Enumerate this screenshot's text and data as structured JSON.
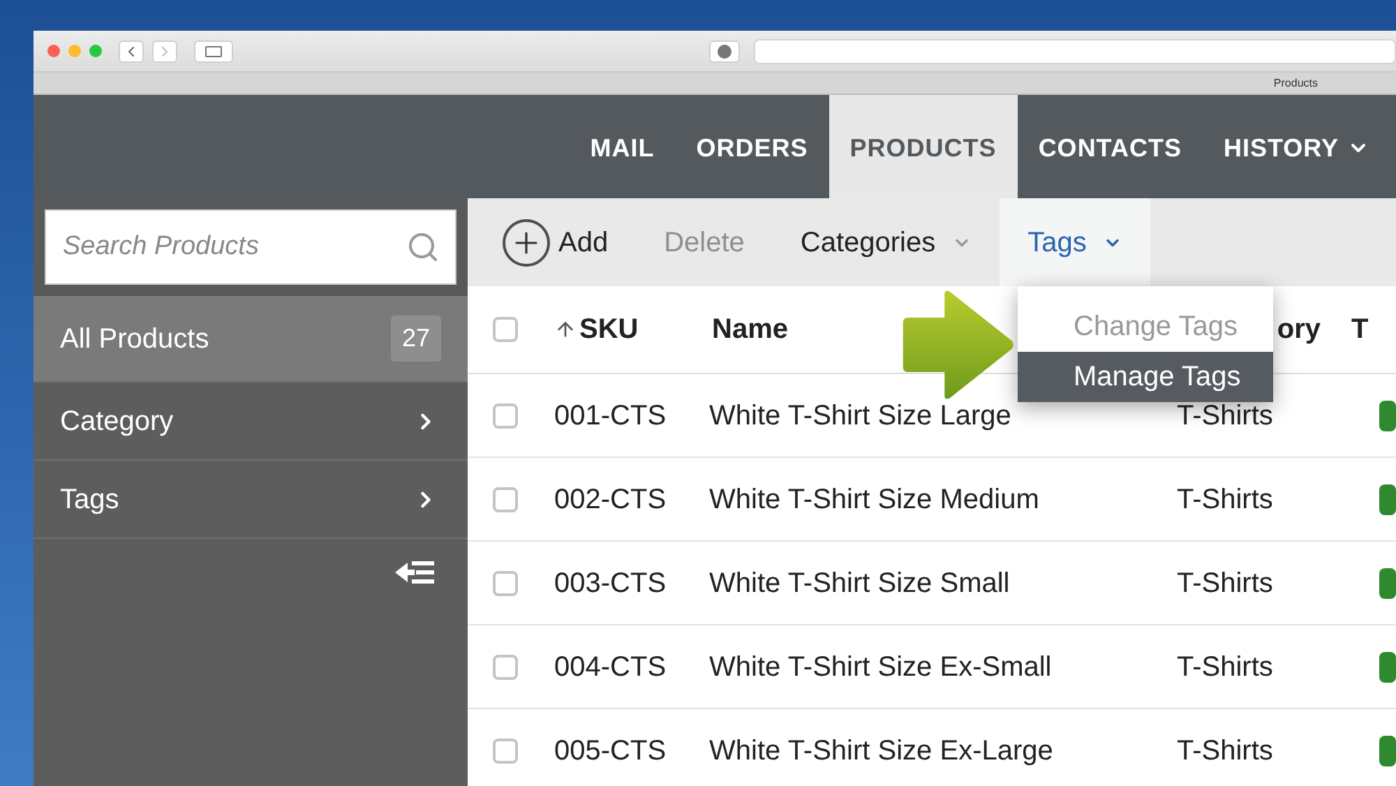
{
  "window": {
    "tab_title": "Products"
  },
  "nav": [
    {
      "label": "MAIL",
      "selected": false,
      "has_caret": false
    },
    {
      "label": "ORDERS",
      "selected": false,
      "has_caret": false
    },
    {
      "label": "PRODUCTS",
      "selected": true,
      "has_caret": false
    },
    {
      "label": "CONTACTS",
      "selected": false,
      "has_caret": false
    },
    {
      "label": "HISTORY",
      "selected": false,
      "has_caret": true
    }
  ],
  "search": {
    "placeholder": "Search Products"
  },
  "sidebar": {
    "items": [
      {
        "label": "All Products",
        "selected": true,
        "count": "27"
      },
      {
        "label": "Category",
        "selected": false
      },
      {
        "label": "Tags",
        "selected": false
      }
    ]
  },
  "toolbar": [
    {
      "kind": "add",
      "label": "Add",
      "disabled": false,
      "selected": false
    },
    {
      "kind": "plain",
      "label": "Delete",
      "disabled": true,
      "selected": false
    },
    {
      "kind": "menu",
      "label": "Categories",
      "disabled": false,
      "selected": false
    },
    {
      "kind": "menu",
      "label": "Tags",
      "disabled": false,
      "selected": true
    }
  ],
  "menu": {
    "items": [
      {
        "label": "Change Tags",
        "disabled": true,
        "selected": false
      },
      {
        "label": "Manage Tags",
        "disabled": false,
        "selected": true
      }
    ]
  },
  "table": {
    "select_all_checked": false,
    "columns": [
      {
        "label": "SKU",
        "sorted": true
      },
      {
        "label": "Name",
        "sorted": false
      },
      {
        "label": "ory",
        "sorted": false
      },
      {
        "label": "T",
        "sorted": false
      }
    ],
    "rows": [
      {
        "checked": false,
        "cells": [
          "001-CTS",
          "White T-Shirt Size Large",
          "T-Shirts"
        ]
      },
      {
        "checked": false,
        "cells": [
          "002-CTS",
          "White T-Shirt Size Medium",
          "T-Shirts"
        ]
      },
      {
        "checked": false,
        "cells": [
          "003-CTS",
          "White T-Shirt Size Small",
          "T-Shirts"
        ]
      },
      {
        "checked": false,
        "cells": [
          "004-CTS",
          "White T-Shirt Size Ex-Small",
          "T-Shirts"
        ]
      },
      {
        "checked": false,
        "cells": [
          "005-CTS",
          "White T-Shirt Size Ex-Large",
          "T-Shirts"
        ]
      }
    ]
  }
}
